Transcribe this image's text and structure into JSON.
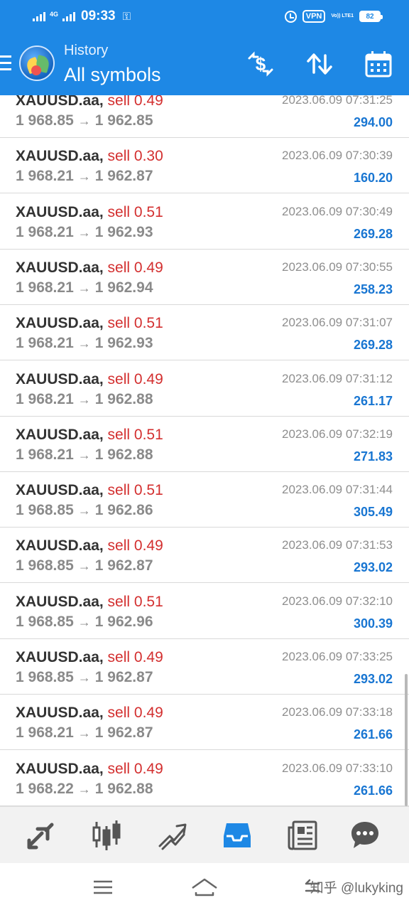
{
  "status_bar": {
    "network": "4G",
    "time": "09:33",
    "vpn": "VPN",
    "volte": "Vo)) LTE1",
    "battery": "82"
  },
  "header": {
    "subtitle": "History",
    "title": "All symbols",
    "icons": [
      "menu-icon",
      "app-logo",
      "currency-exchange-icon",
      "sort-icon",
      "calendar-icon"
    ]
  },
  "trades": [
    {
      "symbol": "XAUUSD.aa",
      "side": "sell",
      "volume": "0.49",
      "open": "1 968.85",
      "close": "1 962.85",
      "time": "2023.06.09 07:31:25",
      "profit": "294.00"
    },
    {
      "symbol": "XAUUSD.aa",
      "side": "sell",
      "volume": "0.30",
      "open": "1 968.21",
      "close": "1 962.87",
      "time": "2023.06.09 07:30:39",
      "profit": "160.20"
    },
    {
      "symbol": "XAUUSD.aa",
      "side": "sell",
      "volume": "0.51",
      "open": "1 968.21",
      "close": "1 962.93",
      "time": "2023.06.09 07:30:49",
      "profit": "269.28"
    },
    {
      "symbol": "XAUUSD.aa",
      "side": "sell",
      "volume": "0.49",
      "open": "1 968.21",
      "close": "1 962.94",
      "time": "2023.06.09 07:30:55",
      "profit": "258.23"
    },
    {
      "symbol": "XAUUSD.aa",
      "side": "sell",
      "volume": "0.51",
      "open": "1 968.21",
      "close": "1 962.93",
      "time": "2023.06.09 07:31:07",
      "profit": "269.28"
    },
    {
      "symbol": "XAUUSD.aa",
      "side": "sell",
      "volume": "0.49",
      "open": "1 968.21",
      "close": "1 962.88",
      "time": "2023.06.09 07:31:12",
      "profit": "261.17"
    },
    {
      "symbol": "XAUUSD.aa",
      "side": "sell",
      "volume": "0.51",
      "open": "1 968.21",
      "close": "1 962.88",
      "time": "2023.06.09 07:32:19",
      "profit": "271.83"
    },
    {
      "symbol": "XAUUSD.aa",
      "side": "sell",
      "volume": "0.51",
      "open": "1 968.85",
      "close": "1 962.86",
      "time": "2023.06.09 07:31:44",
      "profit": "305.49"
    },
    {
      "symbol": "XAUUSD.aa",
      "side": "sell",
      "volume": "0.49",
      "open": "1 968.85",
      "close": "1 962.87",
      "time": "2023.06.09 07:31:53",
      "profit": "293.02"
    },
    {
      "symbol": "XAUUSD.aa",
      "side": "sell",
      "volume": "0.51",
      "open": "1 968.85",
      "close": "1 962.96",
      "time": "2023.06.09 07:32:10",
      "profit": "300.39"
    },
    {
      "symbol": "XAUUSD.aa",
      "side": "sell",
      "volume": "0.49",
      "open": "1 968.85",
      "close": "1 962.87",
      "time": "2023.06.09 07:33:25",
      "profit": "293.02"
    },
    {
      "symbol": "XAUUSD.aa",
      "side": "sell",
      "volume": "0.49",
      "open": "1 968.21",
      "close": "1 962.87",
      "time": "2023.06.09 07:33:18",
      "profit": "261.66"
    },
    {
      "symbol": "XAUUSD.aa",
      "side": "sell",
      "volume": "0.49",
      "open": "1 968.22",
      "close": "1 962.88",
      "time": "2023.06.09 07:33:10",
      "profit": "261.66"
    }
  ],
  "bottom_nav": [
    {
      "name": "quotes",
      "icon": "quotes-arrows-icon"
    },
    {
      "name": "chart",
      "icon": "candlestick-chart-icon"
    },
    {
      "name": "trade",
      "icon": "trade-trend-icon"
    },
    {
      "name": "history",
      "icon": "inbox-history-icon",
      "active": true
    },
    {
      "name": "news",
      "icon": "news-icon"
    },
    {
      "name": "messages",
      "icon": "chat-bubble-icon"
    }
  ],
  "system_nav": {
    "watermark": "知乎 @lukyking"
  },
  "colors": {
    "primary": "#1e88e5",
    "sell": "#d32f2f",
    "profit": "#1976d2",
    "price": "#8a8a8a",
    "nav_inactive": "#555555",
    "nav_active": "#1e88e5"
  }
}
